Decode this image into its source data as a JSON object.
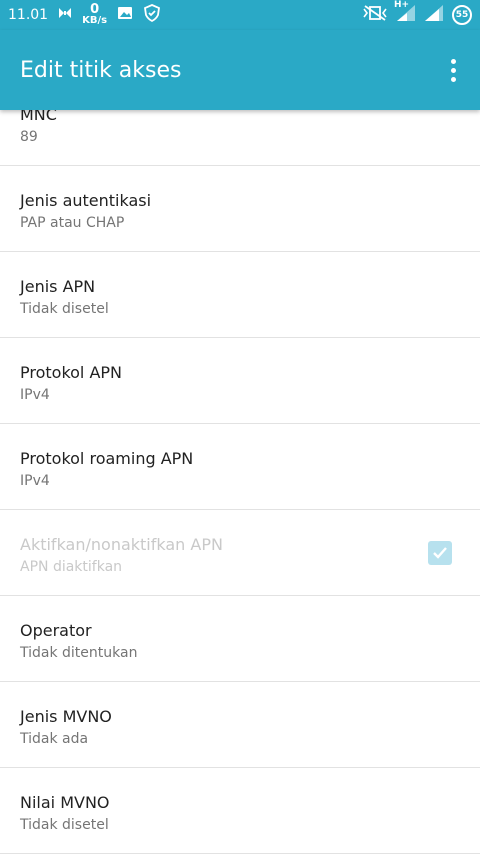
{
  "status_bar": {
    "time": "11.01",
    "net_speed_value": "0",
    "net_speed_unit": "KB/s",
    "battery": "55",
    "data_type": "H+"
  },
  "app_bar": {
    "title": "Edit titik akses"
  },
  "settings": [
    {
      "title": "MNC",
      "summary": "89"
    },
    {
      "title": "Jenis autentikasi",
      "summary": "PAP atau CHAP"
    },
    {
      "title": "Jenis APN",
      "summary": "Tidak disetel"
    },
    {
      "title": "Protokol APN",
      "summary": "IPv4"
    },
    {
      "title": "Protokol roaming APN",
      "summary": "IPv4"
    },
    {
      "title": "Aktifkan/nonaktifkan APN",
      "summary": "APN diaktifkan",
      "enabled": false,
      "checked": true
    },
    {
      "title": "Operator",
      "summary": "Tidak ditentukan"
    },
    {
      "title": "Jenis MVNO",
      "summary": "Tidak ada"
    },
    {
      "title": "Nilai MVNO",
      "summary": "Tidak disetel"
    }
  ],
  "colors": {
    "accent": "#2aa9c6",
    "checkbox_disabled": "#b7e1ee"
  }
}
